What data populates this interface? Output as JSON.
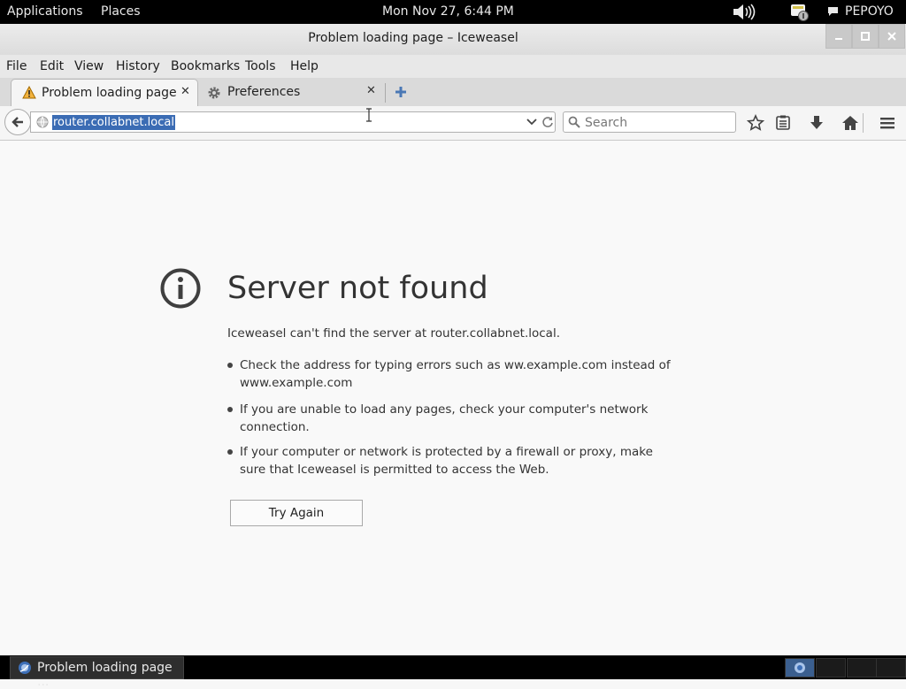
{
  "topbar": {
    "applications": "Applications",
    "places": "Places",
    "datetime": "Mon Nov 27,  6:44 PM",
    "user": "PEPOYO"
  },
  "window": {
    "title": "Problem loading page – Iceweasel"
  },
  "menubar": {
    "items": [
      "File",
      "Edit",
      "View",
      "History",
      "Bookmarks",
      "Tools",
      "Help"
    ]
  },
  "tabs": [
    {
      "label": "Problem loading page",
      "icon": "warning-icon",
      "active": true
    },
    {
      "label": "Preferences",
      "icon": "gear-icon",
      "active": false
    }
  ],
  "navbar": {
    "url": "router.collabnet.local",
    "search_placeholder": "Search"
  },
  "error": {
    "title": "Server not found",
    "description": "Iceweasel can't find the server at router.collabnet.local.",
    "bullets": [
      "Check the address for typing errors such as ww.example.com instead of www.example.com",
      "If you are unable to load any pages, check your computer's network connection.",
      "If your computer or network is protected by a firewall or proxy, make sure that Iceweasel is permitted to access the Web."
    ],
    "try_again": "Try Again"
  },
  "taskbar": {
    "item_label": "Problem loading page ..."
  },
  "colors": {
    "url_selection": "#3b6cb4",
    "topbar_bg": "#000000"
  }
}
